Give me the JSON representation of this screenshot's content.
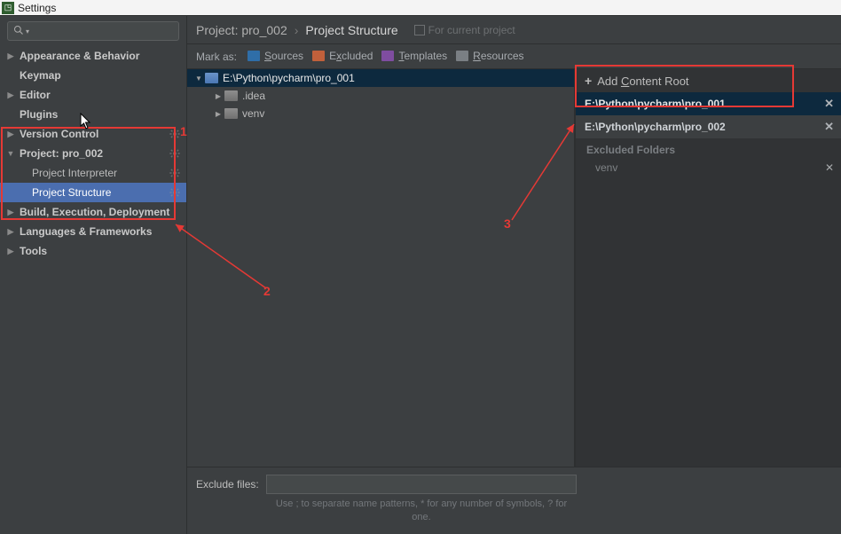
{
  "window": {
    "title": "Settings"
  },
  "sidebar": {
    "search_placeholder": "",
    "items": [
      {
        "label": "Appearance & Behavior",
        "bold": true,
        "arrow": "right"
      },
      {
        "label": "Keymap",
        "bold": true,
        "arrow": "none"
      },
      {
        "label": "Editor",
        "bold": true,
        "arrow": "right"
      },
      {
        "label": "Plugins",
        "bold": true,
        "arrow": "none"
      },
      {
        "label": "Version Control",
        "bold": true,
        "arrow": "right",
        "gear": true
      },
      {
        "label": "Project: pro_002",
        "bold": true,
        "arrow": "down",
        "gear": true
      },
      {
        "label": "Project Interpreter",
        "bold": false,
        "arrow": "none",
        "child": true,
        "gear": true
      },
      {
        "label": "Project Structure",
        "bold": false,
        "arrow": "none",
        "child": true,
        "gear": true,
        "selected": true
      },
      {
        "label": "Build, Execution, Deployment",
        "bold": true,
        "arrow": "right"
      },
      {
        "label": "Languages & Frameworks",
        "bold": true,
        "arrow": "right"
      },
      {
        "label": "Tools",
        "bold": true,
        "arrow": "right"
      }
    ]
  },
  "breadcrumbs": {
    "project_label": "Project: pro_002",
    "page_label": "Project Structure",
    "for_current_label": "For current project"
  },
  "mark_row": {
    "prefix": "Mark as:",
    "chips": [
      {
        "label_pre": "",
        "mnemonic": "S",
        "label_post": "ources",
        "color": "#2f6ea8"
      },
      {
        "label_pre": "E",
        "mnemonic": "x",
        "label_post": "cluded",
        "color": "#c1603b"
      },
      {
        "label_pre": "",
        "mnemonic": "T",
        "label_post": "emplates",
        "color": "#7f4da0"
      },
      {
        "label_pre": "",
        "mnemonic": "R",
        "label_post": "esources",
        "color": "#7a7f84"
      }
    ]
  },
  "tree": {
    "root": "E:\\Python\\pycharm\\pro_001",
    "children": [
      {
        "label": ".idea"
      },
      {
        "label": "venv"
      }
    ]
  },
  "roots_panel": {
    "add_label_pre": "Add ",
    "add_mnemonic": "C",
    "add_label_post": "ontent Root",
    "roots": [
      {
        "path": "E:\\Python\\pycharm\\pro_001",
        "active": true
      },
      {
        "path": "E:\\Python\\pycharm\\pro_002",
        "active": false
      }
    ],
    "excluded_header": "Excluded Folders",
    "excluded_items": [
      {
        "label": "venv"
      }
    ]
  },
  "exclude": {
    "label": "Exclude files:",
    "value": "",
    "hint": "Use ; to separate name patterns, * for any number of symbols, ? for one."
  },
  "annotations": {
    "n1": "1",
    "n2": "2",
    "n3": "3"
  }
}
